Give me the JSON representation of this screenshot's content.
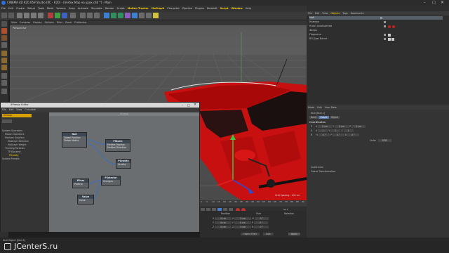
{
  "window": {
    "title": "CINEMA 4D R20.059 Studio (RC - R20) - [Vertex Map на урок.c4d *] - Main"
  },
  "menu": {
    "items": [
      "File",
      "Edit",
      "Create",
      "Select",
      "Tools",
      "Mesh",
      "Volume",
      "Snap",
      "Animate",
      "Simulate",
      "Render",
      "Sculpt",
      "Motion Tracker",
      "MoGraph",
      "Character",
      "Pipeline",
      "Plugins",
      "Redshift",
      "Script",
      "Window",
      "Help"
    ],
    "layout_label": "Layout:",
    "layout_value": "Standard"
  },
  "viewport": {
    "menu": [
      "View",
      "Cameras",
      "Display",
      "Options",
      "Filter",
      "Panel",
      "ProRender"
    ],
    "label": "Perspective",
    "grid_spacing": "Grid Spacing : 100 cm"
  },
  "object_manager": {
    "menu": [
      "File",
      "Edit",
      "View",
      "Objects",
      "Tags",
      "Bookmarks"
    ],
    "objects": [
      {
        "name": "Null",
        "color": "#c9c9c9"
      },
      {
        "name": "Камера",
        "color": "#c9c9c9"
      },
      {
        "name": "Ключ освещения",
        "color": "#c9c9c9"
      },
      {
        "name": "Зверь",
        "color": "#c9c9c9"
      },
      {
        "name": "Подмена",
        "color": "#c9c9c9"
      },
      {
        "name": "ВЗ Дом Ванэг",
        "color": "#c9c9c9"
      }
    ]
  },
  "attributes": {
    "menu": [
      "Mode",
      "Edit",
      "User Data"
    ],
    "object_label": "Null [Null.1]",
    "tabs": [
      "Basic",
      "Coord.",
      "Object"
    ],
    "section": "Coordinates",
    "rows": [
      {
        "axis": "P",
        "x": "X",
        "xv": "0 cm",
        "y": "Y",
        "yv": "0 cm",
        "z": "Z",
        "zv": "0 cm"
      },
      {
        "axis": "S",
        "x": "X",
        "xv": "1",
        "y": "Y",
        "yv": "1",
        "z": "Z",
        "zv": "1"
      },
      {
        "axis": "R",
        "x": "H",
        "xv": "0 °",
        "y": "P",
        "yv": "0 °",
        "z": "B",
        "zv": "0 °"
      }
    ],
    "order_label": "Order",
    "order_value": "HPB",
    "quaternion": "Quaternion",
    "freeze": "Freeze Transformation"
  },
  "timeline": {
    "ticks": [
      "0",
      "5",
      "10",
      "15",
      "20",
      "25",
      "30",
      "35",
      "40",
      "45",
      "50",
      "55",
      "60",
      "65",
      "70",
      "75",
      "80",
      "85",
      "90"
    ],
    "frame": "0 F",
    "end_frame": "90 F"
  },
  "coord_panel": {
    "headers": [
      "Position",
      "Size",
      "Rotation"
    ],
    "rows": [
      {
        "a": "X",
        "av": "0 cm",
        "b": "X",
        "bv": "0 cm",
        "c": "H",
        "cv": "0 °"
      },
      {
        "a": "Y",
        "av": "0 cm",
        "b": "Y",
        "bv": "0 cm",
        "c": "P",
        "cv": "0 °"
      },
      {
        "a": "Z",
        "av": "0 cm",
        "b": "Z",
        "bv": "0 cm",
        "c": "B",
        "cv": "0 °"
      }
    ],
    "mode": "Object (Rel)",
    "size_mode": "Size",
    "apply": "Apply"
  },
  "status": {
    "text": "Null Object [Null.1]",
    "watermark": "JCenterS.ru"
  },
  "xpresso": {
    "title": "XPresso Editor",
    "menu": [
      "File",
      "Edit",
      "View",
      "Calculate"
    ],
    "tabs": [
      "XGroup"
    ],
    "canvas_title": "XGroup",
    "tree": [
      "System Operators",
      "Maxon Operators",
      "Medium Graphics",
      "MoGraph Selection",
      "MoGraph Weight",
      "Thinking Particles",
      "TP Dynamic",
      "PGravity",
      "System Presets"
    ],
    "nodes": [
      {
        "name": "Null",
        "ports": [
          "Global Position",
          "Global Matrix"
        ]
      },
      {
        "name": "PStorm",
        "ports": [
          "Emitter Position",
          "Emitter Direction"
        ]
      },
      {
        "name": "PGravity",
        "ports": [
          "Gravity"
        ]
      },
      {
        "name": "PPass",
        "ports": [
          "Particle"
        ]
      },
      {
        "name": "PSelector",
        "ports": [
          "Changes"
        ]
      },
      {
        "name": "Value",
        "ports": [
          "Value"
        ]
      }
    ]
  }
}
